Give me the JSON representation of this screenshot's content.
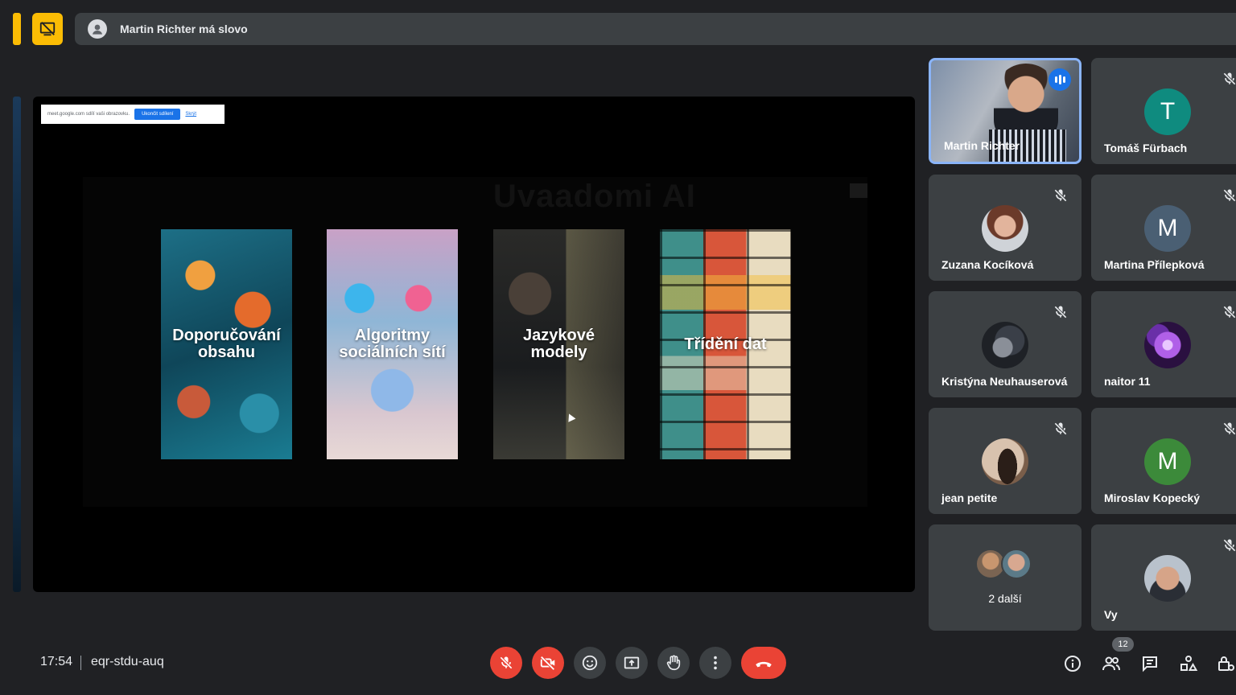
{
  "top": {
    "speaker_text": "Martin Richter má slovo"
  },
  "presentation": {
    "share_notice": {
      "text": "meet.google.com sdílí vaši obrazovku.",
      "stop_label": "Ukončit sdílení",
      "hide_label": "Skrýt"
    },
    "slide_heading": "Uvaadomi AI",
    "cards": [
      {
        "title": "Doporučování obsahu"
      },
      {
        "title": "Algoritmy sociálních sítí"
      },
      {
        "title": "Jazykové modely"
      },
      {
        "title": "Třídění dat"
      }
    ]
  },
  "participants": [
    {
      "name": "Martin Richter",
      "speaking": true,
      "avatar": "photo"
    },
    {
      "name": "Tomáš Fürbach",
      "initial": "T",
      "color": "#0f8b7f",
      "muted": true
    },
    {
      "name": "Zuzana Kocíková",
      "avatar": "photo",
      "muted": true
    },
    {
      "name": "Martina Přílepková",
      "initial": "M",
      "color": "#4a5f73",
      "muted": true
    },
    {
      "name": "Kristýna Neuhauserová",
      "avatar": "photo",
      "muted": true
    },
    {
      "name": "naitor 11",
      "avatar": "photo",
      "muted": true
    },
    {
      "name": "jean petite",
      "avatar": "photo",
      "muted": true
    },
    {
      "name": "Miroslav Kopecký",
      "initial": "M",
      "color": "#3c8a3a",
      "muted": true
    },
    {
      "name": "Vy",
      "avatar": "photo",
      "muted": true
    }
  ],
  "more_tile": {
    "label": "2 další"
  },
  "bottom": {
    "time": "17:54",
    "meeting_code": "eqr-stdu-auq",
    "participant_count": "12"
  },
  "colors": {
    "background": "#202124",
    "tile": "#3c4043",
    "danger": "#ea4335",
    "accent_yellow": "#fbbc04",
    "active_border": "#8ab4f8"
  }
}
